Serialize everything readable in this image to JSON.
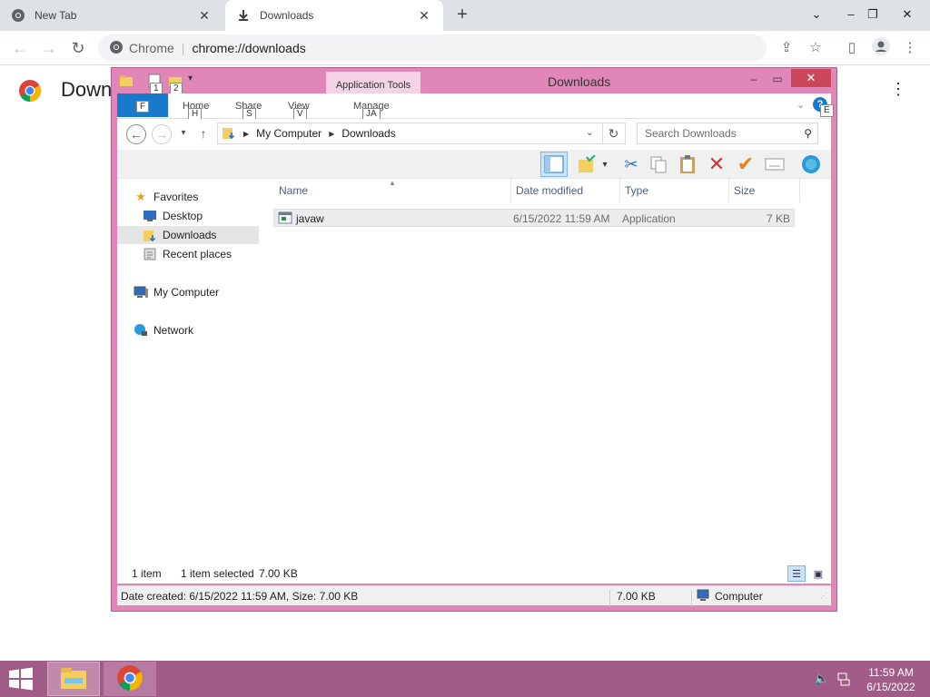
{
  "browser": {
    "tabs": [
      {
        "title": "New Tab",
        "icon": "chrome-icon"
      },
      {
        "title": "Downloads",
        "icon": "download-icon"
      }
    ],
    "omnibox": {
      "site": "Chrome",
      "url": "chrome://downloads"
    },
    "page_title": "Downloads"
  },
  "explorer": {
    "title": "Downloads",
    "app_tools_label": "Application Tools",
    "quick_access_keytips": [
      "1",
      "2"
    ],
    "ribbon": {
      "file_tab": "F",
      "tabs": [
        {
          "label": "Home",
          "keytip": "H"
        },
        {
          "label": "Share",
          "keytip": "S"
        },
        {
          "label": "View",
          "keytip": "V"
        },
        {
          "label": "Manage",
          "keytip": "JA"
        }
      ],
      "help_keytip": "E"
    },
    "address": {
      "crumbs": [
        "My Computer",
        "Downloads"
      ],
      "search_placeholder": "Search Downloads"
    },
    "nav": {
      "favorites": "Favorites",
      "desktop": "Desktop",
      "downloads": "Downloads",
      "recent": "Recent places",
      "computer": "My Computer",
      "network": "Network"
    },
    "columns": {
      "name": "Name",
      "date": "Date modified",
      "type": "Type",
      "size": "Size"
    },
    "files": [
      {
        "name": "javaw",
        "date": "6/15/2022 11:59 AM",
        "type": "Application",
        "size": "7 KB"
      }
    ],
    "status": {
      "count": "1 item",
      "selected": "1 item selected",
      "selected_size": "7.00 KB"
    },
    "details_bar": {
      "info": "Date created: 6/15/2022 11:59 AM, Size: 7.00 KB",
      "size": "7.00 KB",
      "location": "Computer"
    }
  },
  "taskbar": {
    "time": "11:59 AM",
    "date": "6/15/2022"
  },
  "colors": {
    "window_frame": "#e087b8",
    "taskbar": "#a05c86",
    "file_tab": "#1979ca",
    "close": "#c9475a"
  }
}
